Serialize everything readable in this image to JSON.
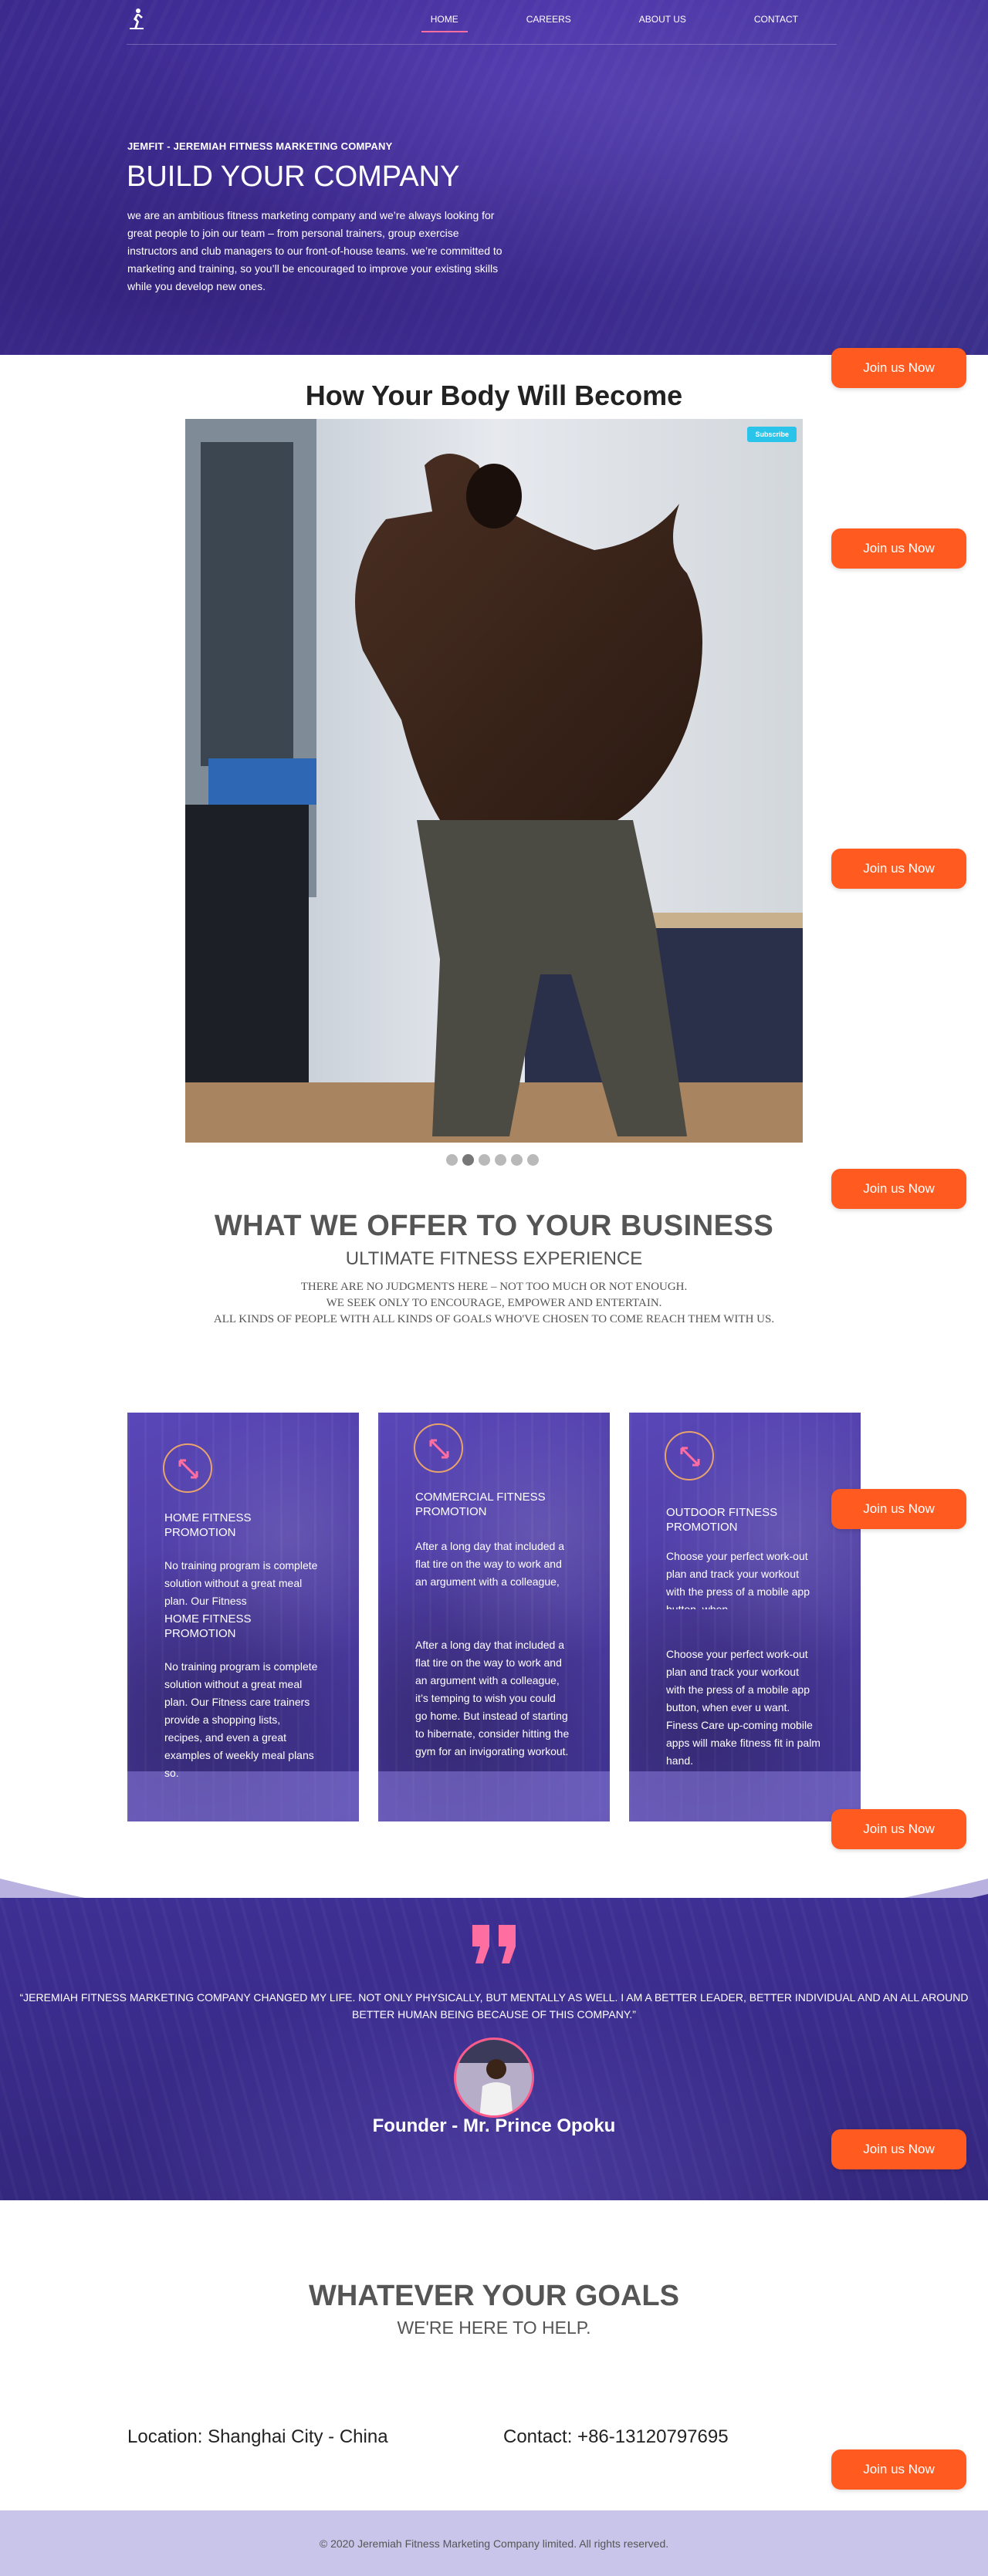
{
  "nav": {
    "links": [
      "HOME",
      "CAREERS",
      "ABOUT US",
      "CONTACT"
    ]
  },
  "hero": {
    "subtitle": "JEMFIT - JEREMIAH FITNESS MARKETING COMPANY",
    "title": "BUILD YOUR COMPANY",
    "text": "we are an ambitious fitness marketing company and we’re always looking for great people to join our team – from personal trainers, group exercise instructors and club managers to our front-of-house teams. we’re committed to marketing and training, so you’ll be encouraged to improve your existing skills while you develop new ones."
  },
  "join_label": "Join us Now",
  "body": {
    "title": "How Your Body Will Become",
    "subscribe_label": "Subscribe"
  },
  "offer": {
    "title": "WHAT WE OFFER TO YOUR BUSINESS",
    "subtitle": "ULTIMATE FITNESS EXPERIENCE",
    "line1": "THERE ARE NO JUDGMENTS HERE – NOT TOO MUCH OR NOT ENOUGH.",
    "line2": "WE SEEK ONLY TO ENCOURAGE, EMPOWER AND ENTERTAIN.",
    "line3": "ALL KINDS OF PEOPLE WITH ALL KINDS OF GOALS WHO'VE CHOSEN TO COME REACH THEM WITH US."
  },
  "cards": [
    {
      "title": "HOME FITNESS PROMOTION",
      "text_short": "No training program is complete solution without a great meal plan. Our Fitness",
      "text": "No training program is complete solution without a great meal plan. Our Fitness care trainers provide a shopping lists, recipes, and even a great examples of weekly meal plans so."
    },
    {
      "title": "COMMERCIAL FITNESS PROMOTION",
      "text_short": "After a long day that included a flat tire on the way to work and an argument with a colleague,",
      "text": "After a long day that included a flat tire on the way to work and an argument with a colleague, it’s temping to wish you could go home. But instead of starting to hibernate, consider hitting the gym for an invigorating workout."
    },
    {
      "title": "OUTDOOR FITNESS PROMOTION",
      "text_short": "Choose your perfect work-out plan and track your workout with the press of a mobile app button, when",
      "text": "Choose your perfect work-out plan and track your workout with the press of a mobile app button, when ever u want. Finess Care up-coming mobile apps will make fitness fit in palm hand."
    }
  ],
  "testimonial": {
    "quote": "“JEREMIAH FITNESS MARKETING COMPANY CHANGED MY LIFE. NOT ONLY PHYSICALLY, BUT MENTALLY AS WELL. I AM A BETTER LEADER, BETTER INDIVIDUAL AND AN ALL AROUND BETTER HUMAN BEING BECAUSE OF THIS COMPANY.”",
    "founder": "Founder - Mr. Prince Opoku"
  },
  "goals": {
    "title": "WHATEVER YOUR GOALS",
    "subtitle": "WE'RE HERE TO HELP.",
    "location": "Location: Shanghai City - China",
    "contact": "Contact: +86-13120797695"
  },
  "footer": {
    "copyright": "© 2020 Jeremiah Fitness Marketing Company limited. All rights reserved."
  },
  "colors": {
    "hero_purple": "#3b2a8c",
    "join_orange": "#ff5a1f",
    "nav_underline": "#ff6ea0",
    "footer_bg": "#c9c4ea",
    "subscribe_blue": "#2ac4ea"
  },
  "icons": [
    "runner-logo-icon",
    "expand-arrows-icon",
    "quote-mark-icon"
  ]
}
